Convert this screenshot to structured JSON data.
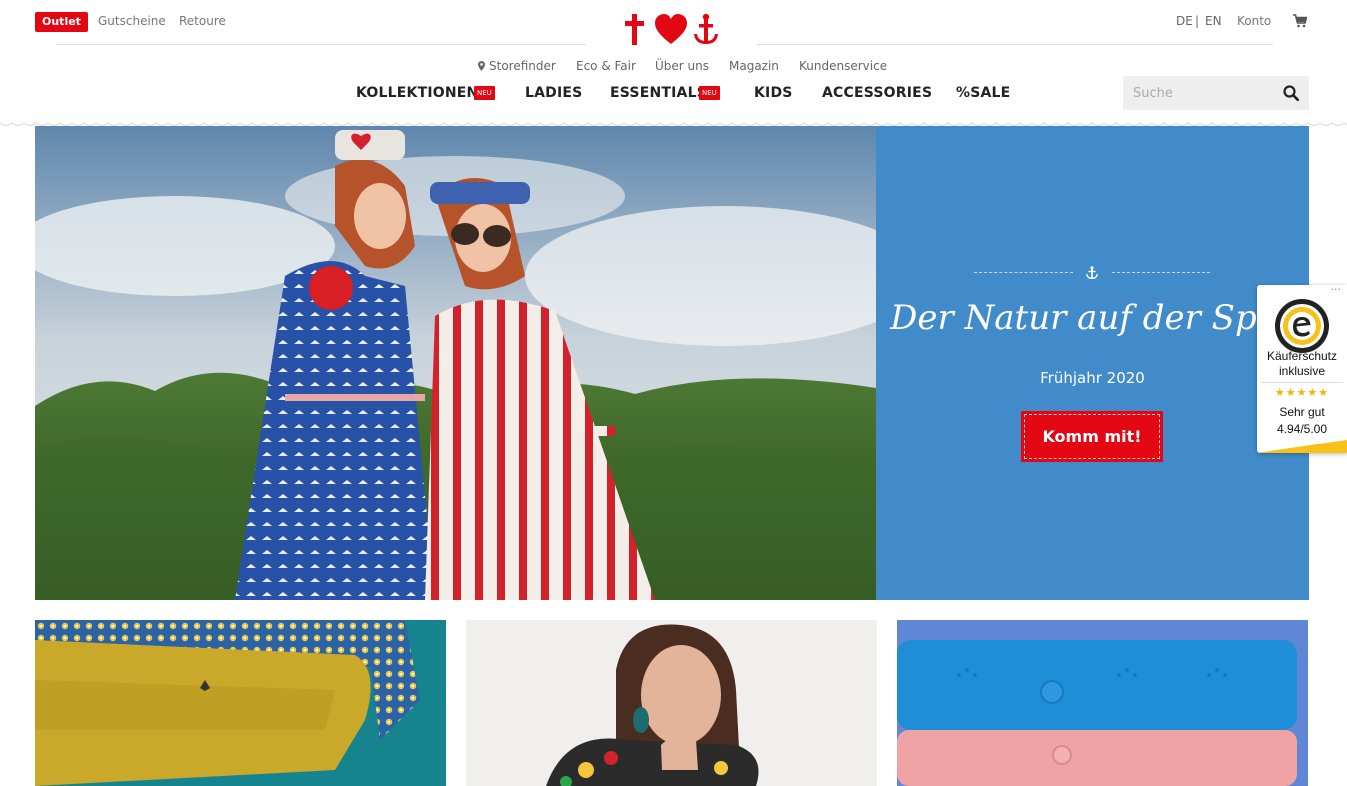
{
  "topbar": {
    "outlet": "Outlet",
    "vouchers": "Gutscheine",
    "returns": "Retoure",
    "lang_de": "DE",
    "lang_sep": "|",
    "lang_en": "EN",
    "account": "Konto"
  },
  "subnav": {
    "storefinder": "Storefinder",
    "eco": "Eco & Fair",
    "about": "Über uns",
    "magazine": "Magazin",
    "service": "Kundenservice"
  },
  "mainnav": {
    "kollektionen": "KOLLEKTIONEN",
    "ladies": "LADIES",
    "essentials": "ESSENTIALS",
    "kids": "KIDS",
    "accessories": "ACCESSORIES",
    "sale": "%SALE",
    "new_badge": "NEU"
  },
  "search": {
    "placeholder": "Suche"
  },
  "hero": {
    "title": "Der Natur auf der Spur",
    "subtitle": "Frühjahr 2020",
    "cta": "Komm mit!"
  },
  "trusted_shops": {
    "dots": "···",
    "line1": "Käuferschutz",
    "line2": "inklusive",
    "stars": "★★★★★",
    "rating_label": "Sehr gut",
    "rating_value": "4.94/5.00"
  },
  "colors": {
    "brand_red": "#e30613",
    "hero_blue": "#418bcb",
    "star_yellow": "#f4b400"
  },
  "icons": [
    "logo-cross-heart-anchor",
    "map-pin-icon",
    "cart-icon",
    "search-icon",
    "anchor-icon",
    "trusted-shops-seal-icon"
  ]
}
